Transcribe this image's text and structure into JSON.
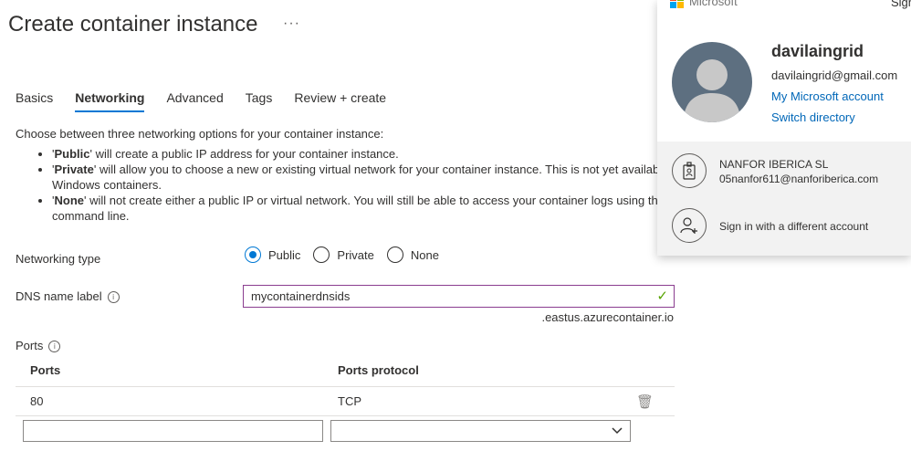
{
  "page": {
    "title": "Create container instance",
    "more_label": "···"
  },
  "tabs": [
    {
      "label": "Basics"
    },
    {
      "label": "Networking"
    },
    {
      "label": "Advanced"
    },
    {
      "label": "Tags"
    },
    {
      "label": "Review + create"
    }
  ],
  "active_tab": "Networking",
  "intro": "Choose between three networking options for your container instance:",
  "bullets": [
    {
      "bold": "Public",
      "quote": "'",
      "text": " will create a public IP address for your container instance."
    },
    {
      "bold": "Private",
      "quote": "'",
      "text": " will allow you to choose a new or existing virtual network for your container instance. This is not yet available for Windows containers."
    },
    {
      "bold": "None",
      "quote": "'",
      "text": " will not create either a public IP or virtual network. You will still be able to access your container logs using the command line."
    }
  ],
  "networking_type": {
    "label": "Networking type",
    "options": [
      "Public",
      "Private",
      "None"
    ],
    "selected": "Public"
  },
  "dns": {
    "label": "DNS name label",
    "info_icon": "info-icon",
    "value": "mycontainerdnsids",
    "suffix": ".eastus.azurecontainer.io",
    "valid_icon": "checkmark-icon"
  },
  "ports": {
    "label": "Ports",
    "columns": [
      "Ports",
      "Ports protocol"
    ],
    "rows": [
      {
        "port": "80",
        "protocol": "TCP"
      }
    ],
    "new_row": {
      "port": "",
      "protocol": ""
    }
  },
  "account_panel": {
    "brand": "Microsoft",
    "sign_out_label": "Sign",
    "user_name": "davilaingrid",
    "user_email": "davilaingrid@gmail.com",
    "links": [
      "My Microsoft account",
      "Switch directory"
    ],
    "organization": {
      "name": "NANFOR IBERICA SL",
      "email": "05nanfor611@nanforiberica.com"
    },
    "other_account": "Sign in with a different account"
  },
  "colors": {
    "accent": "#0078d4",
    "link": "#0067b8",
    "valid": "#57a300",
    "input_focus": "#8a3d8f"
  }
}
